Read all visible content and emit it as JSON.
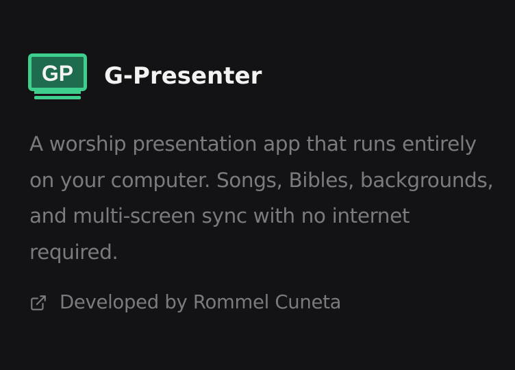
{
  "app": {
    "logo_text": "GP",
    "name": "G-Presenter"
  },
  "description": "A worship presentation app that runs entirely on your computer. Songs, Bibles, backgrounds, and multi-screen sync with no internet required.",
  "credit": {
    "icon": "external-link-icon",
    "text": "Developed by Rommel Cuneta"
  },
  "colors": {
    "background": "#131315",
    "accent": "#3ecf8e",
    "title": "#f3f3f3",
    "muted_text": "#7a7a80"
  }
}
